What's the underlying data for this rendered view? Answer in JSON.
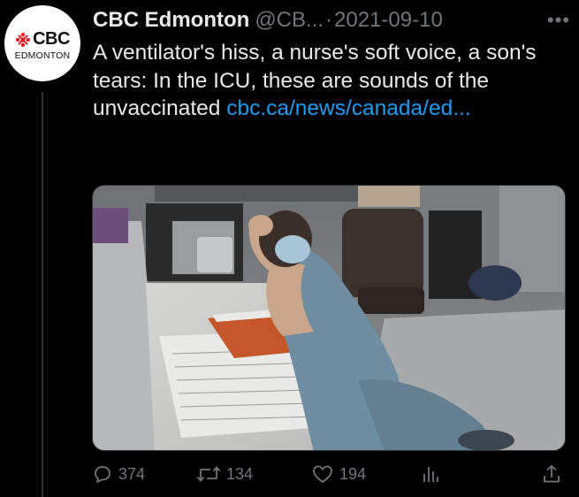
{
  "account": {
    "name": "CBC Edmonton",
    "handle": "@CB...",
    "separator": "·",
    "date": "2021-09-10",
    "avatar_logo": "CBC",
    "avatar_subtitle": "EDMONTON",
    "more_icon": "more-horizontal-icon"
  },
  "tweet": {
    "text": "A ventilator's hiss, a nurse's soft voice, a son's tears: In the ICU, these are sounds of the unvaccinated ",
    "link": "cbc.ca/news/canada/ed..."
  },
  "metrics": {
    "replies": "374",
    "retweets": "134",
    "likes": "194"
  },
  "icons": {
    "reply": "reply-bubble-icon",
    "retweet": "retweet-icon",
    "like": "heart-icon",
    "views": "bar-chart-icon",
    "share": "share-icon"
  },
  "colors": {
    "background": "#000000",
    "text": "#e7e9ea",
    "muted": "#71767b",
    "link": "#1d9bf0",
    "cbc_red": "#e51b24"
  }
}
